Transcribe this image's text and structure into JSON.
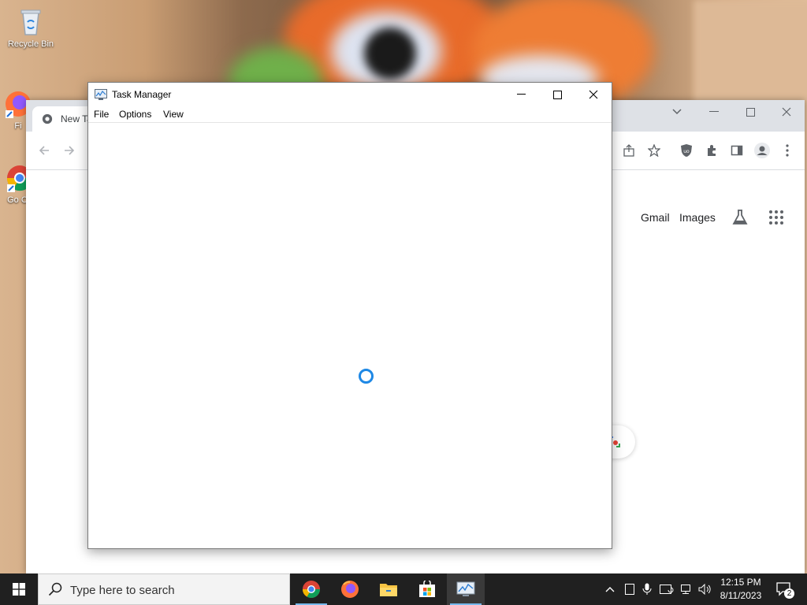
{
  "desktop": {
    "icons": [
      {
        "label": "Recycle Bin",
        "icon": "recycle-bin-icon"
      },
      {
        "label": "Fi",
        "icon": "firefox-shortcut-icon"
      },
      {
        "label": "Go Ch",
        "icon": "chrome-shortcut-icon"
      }
    ]
  },
  "chrome": {
    "tab_title": "New Ta",
    "header_links": {
      "gmail": "Gmail",
      "images": "Images"
    }
  },
  "task_manager": {
    "title": "Task Manager",
    "menu": [
      "File",
      "Options",
      "View"
    ],
    "state": "loading"
  },
  "taskbar": {
    "search_placeholder": "Type here to search",
    "apps": [
      {
        "name": "chrome",
        "icon": "chrome-icon",
        "active": false
      },
      {
        "name": "firefox",
        "icon": "firefox-icon",
        "active": false
      },
      {
        "name": "file-explorer",
        "icon": "folder-icon",
        "active": false
      },
      {
        "name": "microsoft-store",
        "icon": "store-icon",
        "active": false
      },
      {
        "name": "task-manager",
        "icon": "task-manager-icon",
        "active": true
      }
    ],
    "clock": {
      "time": "12:15 PM",
      "date": "8/11/2023"
    },
    "notifications_count": "2"
  },
  "colors": {
    "accent": "#1e88e5",
    "taskbar": "#202020",
    "spinner": "#1e88e5"
  }
}
